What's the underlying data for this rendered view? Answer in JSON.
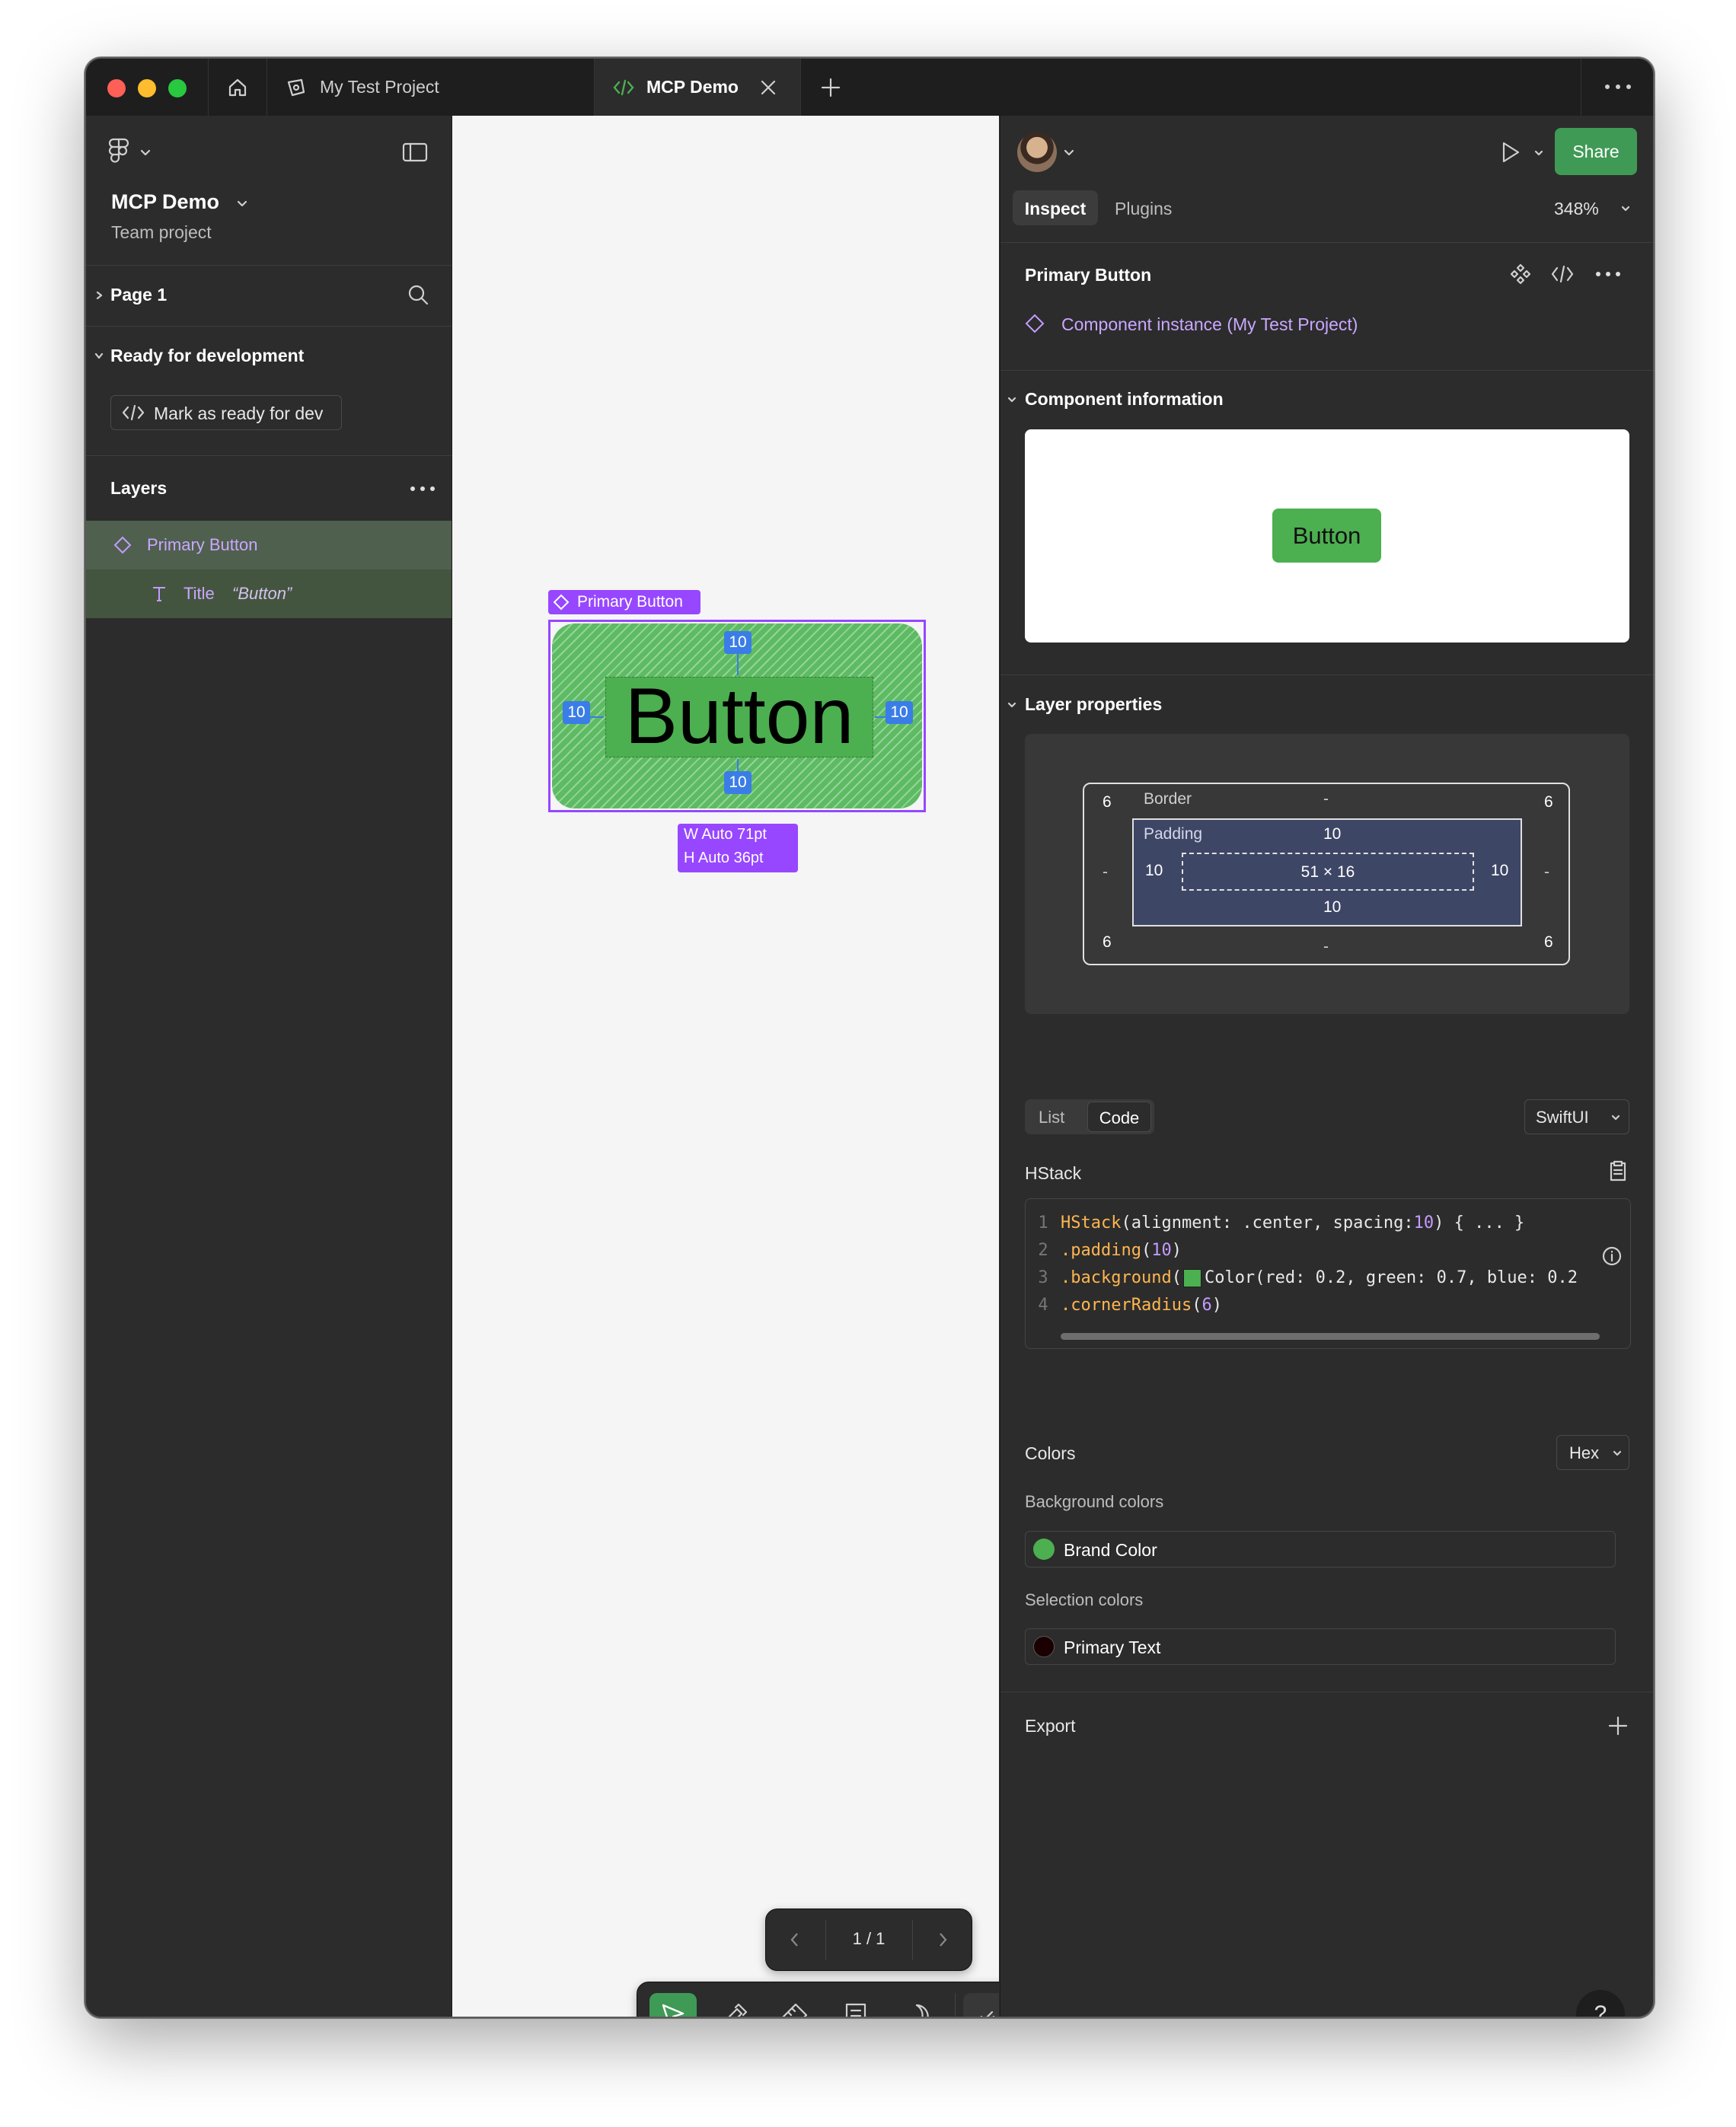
{
  "titlebar": {
    "tabs": [
      {
        "label": "My Test Project"
      },
      {
        "label": "MCP Demo"
      }
    ]
  },
  "left": {
    "file_name": "MCP Demo",
    "project": "Team project",
    "page": "Page 1",
    "dev_section": "Ready for development",
    "mark_ready": "Mark as ready for dev",
    "layers_title": "Layers",
    "layers": [
      {
        "label": "Primary Button",
        "type": "component-instance"
      },
      {
        "label": "Title",
        "content": "“Button”",
        "type": "text"
      }
    ]
  },
  "canvas": {
    "selection_label": "Primary Button",
    "button_text": "Button",
    "padding_top": "10",
    "padding_bottom": "10",
    "padding_left": "10",
    "padding_right": "10",
    "size_w": "W Auto  71pt",
    "size_h": "H Auto  36pt",
    "pagination": "1 / 1"
  },
  "right": {
    "tabs": [
      "Inspect",
      "Plugins"
    ],
    "zoom": "348%",
    "share": "Share",
    "selection_name": "Primary Button",
    "instance_label": "Component instance (My Test Project)",
    "component_info_title": "Component information",
    "preview_button": "Button",
    "layer_props_title": "Layer properties",
    "box": {
      "border_label": "Border",
      "border_top": "-",
      "border_bottom": "-",
      "border_left": "-",
      "border_right": "-",
      "radius_tl": "6",
      "radius_tr": "6",
      "radius_bl": "6",
      "radius_br": "6",
      "padding_label": "Padding",
      "padding_top": "10",
      "padding_bottom": "10",
      "padding_left": "10",
      "padding_right": "10",
      "content_size": "51 × 16"
    },
    "view_tabs": [
      "List",
      "Code"
    ],
    "language": "SwiftUI",
    "code_title": "HStack",
    "code_lines": [
      {
        "n": "1",
        "fn": "HStack",
        "rest": "(alignment: .center, spacing: ",
        "num": "10",
        "tail": ") { ... }"
      },
      {
        "n": "2",
        "fn": ".padding",
        "rest": "(",
        "num": "10",
        "tail": ")"
      },
      {
        "n": "3",
        "fn": ".background",
        "rest": "(",
        "num": "",
        "tail": "Color(red: 0.2, green: 0.7, blue: 0.2"
      },
      {
        "n": "4",
        "fn": ".cornerRadius",
        "rest": "(",
        "num": "6",
        "tail": ")"
      }
    ],
    "colors_title": "Colors",
    "color_format": "Hex",
    "bg_colors_title": "Background colors",
    "bg_color_name": "Brand Color",
    "sel_colors_title": "Selection colors",
    "sel_color_name": "Primary Text",
    "export_title": "Export",
    "help": "?"
  },
  "colors": {
    "brand_green": "#4caf50",
    "selection_purple": "#9747ff",
    "spacing_blue": "#3a7de6",
    "share_green": "#3f9a55",
    "primary_text": "#1a0000"
  }
}
